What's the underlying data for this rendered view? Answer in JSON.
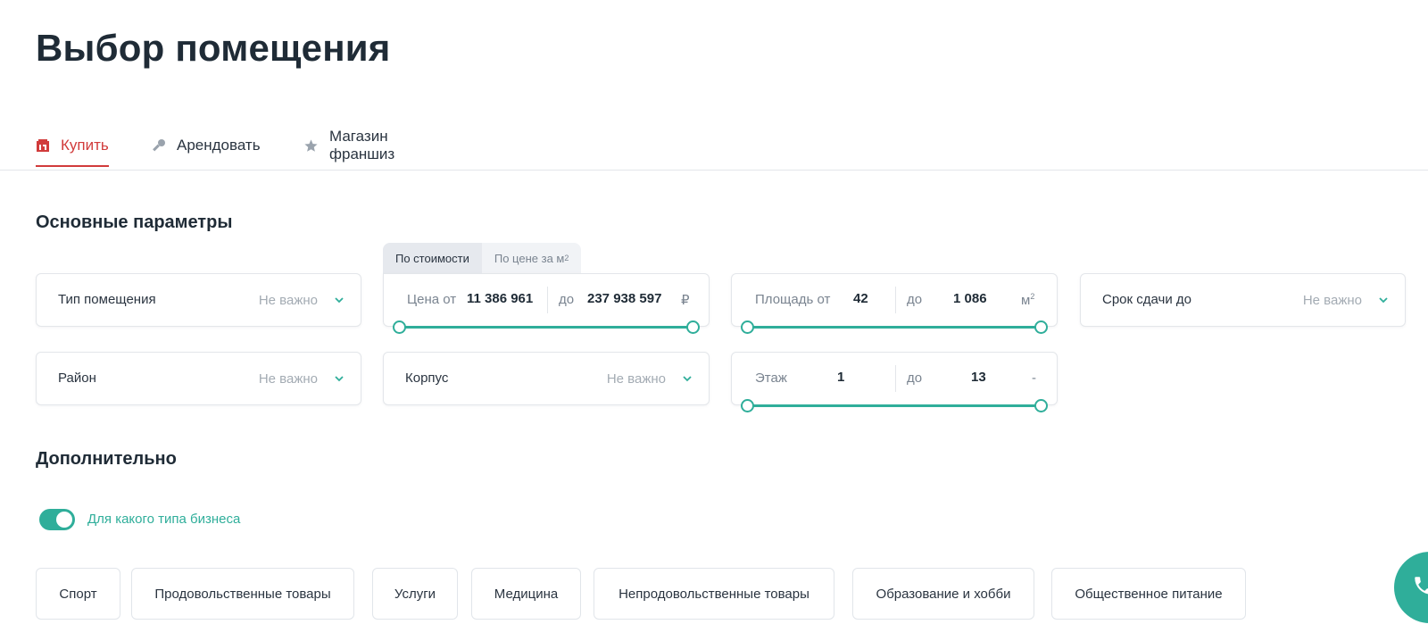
{
  "page": {
    "title": "Выбор помещения"
  },
  "tabs": [
    {
      "label": "Купить",
      "icon": "building-icon",
      "active": true
    },
    {
      "label": "Арендовать",
      "icon": "key-icon",
      "active": false
    },
    {
      "label": "Магазин франшиз",
      "icon": "star-icon",
      "active": false
    }
  ],
  "main_section": {
    "title": "Основные параметры",
    "price_mode": {
      "by_cost": "По стоимости",
      "by_m2": "По цене за м",
      "by_m2_sup": "2",
      "active": "by_cost"
    },
    "type": {
      "label": "Тип помещения",
      "value": "Не важно"
    },
    "price": {
      "label_from": "Цена от",
      "from": "11 386 961",
      "label_to": "до",
      "to": "237 938 597",
      "unit": "₽"
    },
    "area": {
      "label_from": "Площадь от",
      "from": "42",
      "label_to": "до",
      "to": "1 086",
      "unit": "м",
      "unit_sup": "2"
    },
    "deadline": {
      "label": "Срок сдачи до",
      "value": "Не важно"
    },
    "district": {
      "label": "Район",
      "value": "Не важно"
    },
    "building": {
      "label": "Корпус",
      "value": "Не важно"
    },
    "floor": {
      "label_from": "Этаж",
      "from": "1",
      "label_to": "до",
      "to": "13",
      "unit": "-"
    }
  },
  "extra_section": {
    "title": "Дополнительно",
    "toggle": {
      "label": "Для какого типа бизнеса",
      "on": true
    },
    "chips": [
      "Спорт",
      "Продовольственные товары",
      "Услуги",
      "Медицина",
      "Непродовольственные товары",
      "Образование и хобби",
      "Общественное питание"
    ]
  },
  "colors": {
    "accent": "#2fae9a",
    "active_tab": "#d13b3b",
    "text": "#1f2b36",
    "muted": "#a3abb3"
  },
  "call_button": {
    "icon": "phone-icon"
  }
}
